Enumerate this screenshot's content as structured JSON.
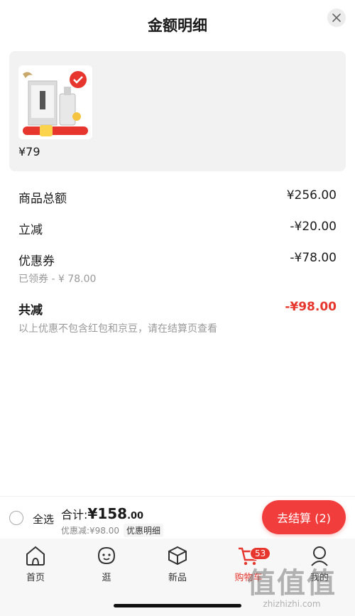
{
  "header": {
    "title": "金额明细",
    "close_icon": "close-icon"
  },
  "product": {
    "price": "¥79"
  },
  "breakdown": [
    {
      "label": "商品总额",
      "value": "¥256.00"
    },
    {
      "label": "立减",
      "value": "-¥20.00"
    },
    {
      "label": "优惠券",
      "value": "-¥78.00",
      "note": "已领券 - ¥ 78.00"
    }
  ],
  "total_reduction": {
    "label": "共减",
    "value": "-¥98.00",
    "note": "以上优惠不包含红包和京豆，请在结算页查看"
  },
  "bottom_bar": {
    "select_all": "全选",
    "total_prefix": "合计:",
    "total_symbol": "¥",
    "total_int": "158",
    "total_dec": ".00",
    "discount": "优惠减:¥98.00",
    "detail_link": "优惠明细",
    "checkout": "去结算 (2)"
  },
  "tabs": [
    {
      "label": "首页",
      "icon": "home-icon"
    },
    {
      "label": "逛",
      "icon": "face-icon"
    },
    {
      "label": "新品",
      "icon": "cube-icon"
    },
    {
      "label": "购物车",
      "icon": "cart-icon",
      "badge": "53",
      "active": true
    },
    {
      "label": "我的",
      "icon": "user-icon"
    }
  ],
  "watermark": {
    "main": "值值值",
    "sub": "zhizhizhi.com"
  },
  "colors": {
    "accent": "#e6362e",
    "button": "#f23d3d"
  }
}
